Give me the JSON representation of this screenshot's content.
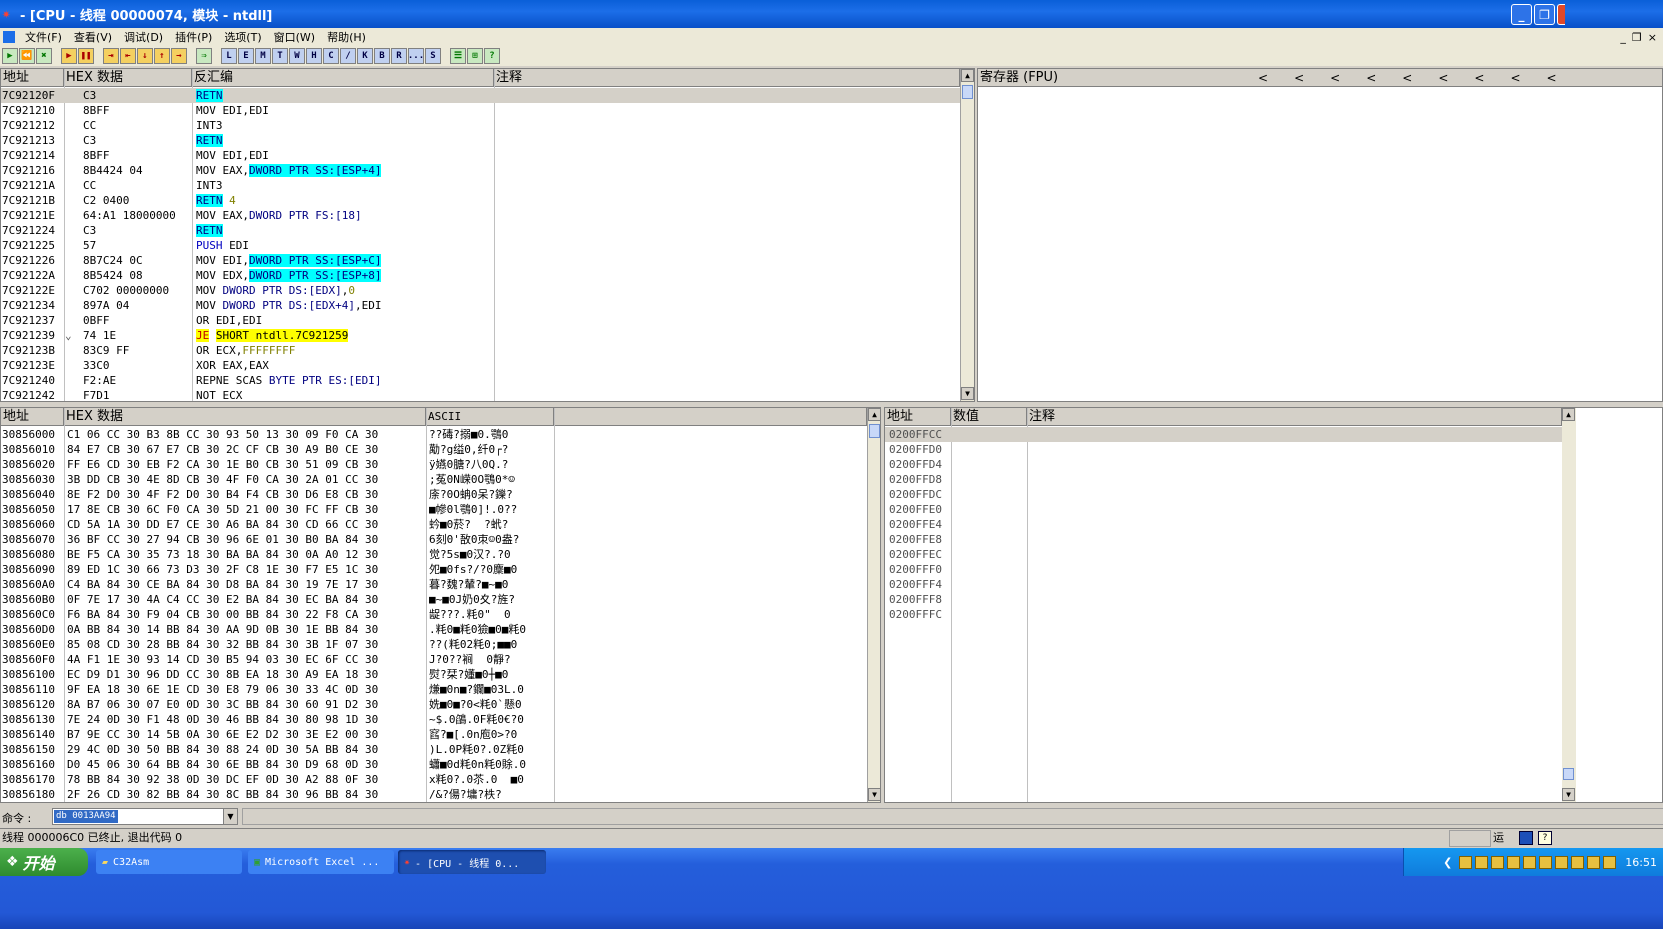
{
  "window": {
    "title": "- [CPU - 线程 00000074, 模块 - ntdll]",
    "app_icon": "star-icon",
    "min_label": "_",
    "max_label": "❐",
    "close_label": "×"
  },
  "menu": {
    "items": [
      "文件(F)",
      "查看(V)",
      "调试(D)",
      "插件(P)",
      "选项(T)",
      "窗口(W)",
      "帮助(H)"
    ],
    "mdi_min": "_",
    "mdi_restore": "❐",
    "mdi_close": "×"
  },
  "toolbar": {
    "buttons": [
      "▶",
      "⏪",
      "✖",
      "▶",
      "❚❚",
      "⇥",
      "⇤",
      "↓",
      "↑",
      "→",
      "⇒",
      "L",
      "E",
      "M",
      "T",
      "W",
      "H",
      "C",
      "/",
      "K",
      "B",
      "R",
      "...",
      "S",
      "☰",
      "⊞",
      "?"
    ]
  },
  "disasm": {
    "headers": {
      "addr": "地址",
      "hex": "HEX 数据",
      "disasm": "反汇编",
      "comment": "注释"
    },
    "rows": [
      {
        "addr": "7C92120F",
        "hex": "C3",
        "parts": [
          {
            "t": "RETN",
            "c": "cyan"
          }
        ],
        "sel": true
      },
      {
        "addr": "7C921210",
        "hex": "8BFF",
        "parts": [
          {
            "t": "MOV EDI,EDI"
          }
        ]
      },
      {
        "addr": "7C921212",
        "hex": "CC",
        "parts": [
          {
            "t": "INT3"
          }
        ]
      },
      {
        "addr": "7C921213",
        "hex": "C3",
        "parts": [
          {
            "t": "RETN",
            "c": "cyan"
          }
        ]
      },
      {
        "addr": "7C921214",
        "hex": "8BFF",
        "parts": [
          {
            "t": "MOV EDI,EDI"
          }
        ]
      },
      {
        "addr": "7C921216",
        "hex": "8B4424 04",
        "parts": [
          {
            "t": "MOV EAX,"
          },
          {
            "t": "DWORD PTR SS:[ESP+4]",
            "c": "cyan"
          }
        ]
      },
      {
        "addr": "7C92121A",
        "hex": "CC",
        "parts": [
          {
            "t": "INT3"
          }
        ]
      },
      {
        "addr": "7C92121B",
        "hex": "C2 0400",
        "parts": [
          {
            "t": "RETN",
            "c": "cyan"
          },
          {
            "t": " 4",
            "c": "num"
          }
        ]
      },
      {
        "addr": "7C92121E",
        "hex": "64:A1 18000000",
        "parts": [
          {
            "t": "MOV EAX,"
          },
          {
            "t": "DWORD PTR FS:[18]",
            "c": "mem"
          }
        ]
      },
      {
        "addr": "7C921224",
        "hex": "C3",
        "parts": [
          {
            "t": "RETN",
            "c": "cyan"
          }
        ]
      },
      {
        "addr": "7C921225",
        "hex": "57",
        "parts": [
          {
            "t": "PUSH",
            "c": "push"
          },
          {
            "t": " EDI"
          }
        ]
      },
      {
        "addr": "7C921226",
        "hex": "8B7C24 0C",
        "parts": [
          {
            "t": "MOV EDI,"
          },
          {
            "t": "DWORD PTR SS:[ESP+C]",
            "c": "cyan"
          }
        ]
      },
      {
        "addr": "7C92122A",
        "hex": "8B5424 08",
        "parts": [
          {
            "t": "MOV EDX,"
          },
          {
            "t": "DWORD PTR SS:[ESP+8]",
            "c": "cyan"
          }
        ]
      },
      {
        "addr": "7C92122E",
        "hex": "C702 00000000",
        "parts": [
          {
            "t": "MOV "
          },
          {
            "t": "DWORD PTR DS:[EDX]",
            "c": "mem"
          },
          {
            "t": ","
          },
          {
            "t": "0",
            "c": "num"
          }
        ]
      },
      {
        "addr": "7C921234",
        "hex": "897A 04",
        "parts": [
          {
            "t": "MOV "
          },
          {
            "t": "DWORD PTR DS:[EDX+4]",
            "c": "mem"
          },
          {
            "t": ",EDI"
          }
        ]
      },
      {
        "addr": "7C921237",
        "hex": "0BFF",
        "parts": [
          {
            "t": "OR EDI,EDI"
          }
        ]
      },
      {
        "addr": "7C921239",
        "hex": "74 1E",
        "mark": "⌄",
        "parts": [
          {
            "t": "JE",
            "c": "jmp"
          },
          {
            "t": " "
          },
          {
            "t": "SHORT ntdll.7C921259",
            "c": "yel"
          }
        ]
      },
      {
        "addr": "7C92123B",
        "hex": "83C9 FF",
        "parts": [
          {
            "t": "OR ECX,"
          },
          {
            "t": "FFFFFFFF",
            "c": "num"
          }
        ]
      },
      {
        "addr": "7C92123E",
        "hex": "33C0",
        "parts": [
          {
            "t": "XOR EAX,EAX"
          }
        ]
      },
      {
        "addr": "7C921240",
        "hex": "F2:AE",
        "parts": [
          {
            "t": "REPNE SCAS "
          },
          {
            "t": "BYTE PTR ES:[EDI]",
            "c": "mem"
          }
        ]
      },
      {
        "addr": "7C921242",
        "hex": "F7D1",
        "parts": [
          {
            "t": "NOT ECX"
          }
        ]
      }
    ]
  },
  "registers": {
    "header": "寄存器 (FPU)",
    "arrows": [
      "<",
      "<",
      "<",
      "<",
      "<",
      "<",
      "<",
      "<",
      "<"
    ]
  },
  "dump": {
    "headers": {
      "addr": "地址",
      "hex": "HEX 数据",
      "ascii": "ASCII"
    },
    "rows": [
      {
        "addr": "30856000",
        "hex": "C1 06 CC 30 B3 8B CC 30 93 50 13 30 09 F0 CA 30",
        "ascii": "??碡?搦■0.鶚0"
      },
      {
        "addr": "30856010",
        "hex": "84 E7 CB 30 67 E7 CB 30 2C CF CB 30 A9 B0 CE 30",
        "ascii": "勱?g缢0,纤0┌?"
      },
      {
        "addr": "30856020",
        "hex": "FF E6 CD 30 EB F2 CA 30 1E B0 CB 30 51 09 CB 30",
        "ascii": "ÿ嬿0膅?八0Q.?"
      },
      {
        "addr": "30856030",
        "hex": "3B DD CB 30 4E 8D CB 30 4F F0 CA 30 2A 01 CC 30",
        "ascii": ";菟0N嵘0O鶚0*☺"
      },
      {
        "addr": "30856040",
        "hex": "8E F2 D0 30 4F F2 D0 30 B4 F4 CB 30 D6 E8 CB 30",
        "ascii": "庩?0O蚺0呆?鑠?"
      },
      {
        "addr": "30856050",
        "hex": "17 8E CB 30 6C F0 CA 30 5D 21 00 30 FC FF CB 30",
        "ascii": "■幓0l鶚0]!.0??"
      },
      {
        "addr": "30856060",
        "hex": "CD 5A 1A 30 DD E7 CE 30 A6 BA 84 30 CD 66 CC 30",
        "ascii": "蚙■0菸?  ?蚮?"
      },
      {
        "addr": "30856070",
        "hex": "36 BF CC 30 27 94 CB 30 96 6E 01 30 B0 BA 84 30",
        "ascii": "6刻0'敔0朿☺0盎?"
      },
      {
        "addr": "30856080",
        "hex": "BE F5 CA 30 35 73 18 30 BA BA 84 30 0A A0 12 30",
        "ascii": "觉?5s■0汉?.?0"
      },
      {
        "addr": "30856090",
        "hex": "89 ED 1C 30 66 73 D3 30 2F C8 1E 30 F7 E5 1C 30",
        "ascii": "夗■0fs?/?0麇■0"
      },
      {
        "addr": "308560A0",
        "hex": "C4 BA 84 30 CE BA 84 30 D8 BA 84 30 19 7E 17 30",
        "ascii": "暮?魏?輦?■~■0"
      },
      {
        "addr": "308560B0",
        "hex": "0F 7E 17 30 4A C4 CC 30 E2 BA 84 30 EC BA 84 30",
        "ascii": "■~■0J奶0夊?旌?"
      },
      {
        "addr": "308560C0",
        "hex": "F6 BA 84 30 F9 04 CB 30 00 BB 84 30 22 F8 CA 30",
        "ascii": "龊???.粍0\"  0"
      },
      {
        "addr": "308560D0",
        "hex": "0A BB 84 30 14 BB 84 30 AA 9D 0B 30 1E BB 84 30",
        "ascii": ".粍0■粍0獫■0■粍0"
      },
      {
        "addr": "308560E0",
        "hex": "85 08 CD 30 28 BB 84 30 32 BB 84 30 3B 1F 07 30",
        "ascii": "??(粍02粍0;■■0"
      },
      {
        "addr": "308560F0",
        "hex": "4A F1 1E 30 93 14 CD 30 B5 94 03 30 EC 6F CC 30",
        "ascii": "J?0??裥  0靜?"
      },
      {
        "addr": "30856100",
        "hex": "EC D9 D1 30 96 DD CC 30 8B EA 18 30 A9 EA 18 30",
        "ascii": "熨?栞?嬞■0┼■0"
      },
      {
        "addr": "30856110",
        "hex": "9F EA 18 30 6E 1E CD 30 E8 79 06 30 33 4C 0D 30",
        "ascii": "熑■0n■?鑭■03L.0"
      },
      {
        "addr": "30856120",
        "hex": "8A B7 06 30 07 E0 0D 30 3C BB 84 30 60 91 D2 30",
        "ascii": "姺■0■?0<粍0`懸0"
      },
      {
        "addr": "30856130",
        "hex": "7E 24 0D 30 F1 48 0D 30 46 BB 84 30 80 98 1D 30",
        "ascii": "~$.0鵮.0F粍0€?0"
      },
      {
        "addr": "30856140",
        "hex": "B7 9E CC 30 14 5B 0A 30 6E E2 D2 30 3E E2 00 30",
        "ascii": "窞?■[.0n庖0>?0"
      },
      {
        "addr": "30856150",
        "hex": "29 4C 0D 30 50 BB 84 30 88 24 0D 30 5A BB 84 30",
        "ascii": ")L.0P粍0?.0Z粍0"
      },
      {
        "addr": "30856160",
        "hex": "D0 45 06 30 64 BB 84 30 6E BB 84 30 D9 68 0D 30",
        "ascii": "蠨■0d粍0n粍0賖.0"
      },
      {
        "addr": "30856170",
        "hex": "78 BB 84 30 92 38 0D 30 DC EF 0D 30 A2 88 0F 30",
        "ascii": "x粍0?.0苶.0  ■0"
      },
      {
        "addr": "30856180",
        "hex": "2F 26 CD 30 82 BB 84 30 8C BB 84 30 96 BB 84 30",
        "ascii": "/&?偒?墉?柣?"
      }
    ]
  },
  "stack": {
    "headers": {
      "addr": "地址",
      "value": "数值",
      "comment": "注释"
    },
    "rows": [
      "0200FFCC",
      "0200FFD0",
      "0200FFD4",
      "0200FFD8",
      "0200FFDC",
      "0200FFE0",
      "0200FFE4",
      "0200FFE8",
      "0200FFEC",
      "0200FFF0",
      "0200FFF4",
      "0200FFF8",
      "0200FFFC"
    ]
  },
  "command": {
    "label": "命令 :",
    "value": "db 0013AA94"
  },
  "status": {
    "text": "线程 000006C0 已终止, 退出代码 0",
    "right": "运"
  },
  "taskbar": {
    "start": "开始",
    "tasks": [
      "C32Asm",
      "Microsoft Excel ...",
      "- [CPU - 线程 0..."
    ],
    "clock": "16:51"
  },
  "colors": {
    "cyan_highlight": "#00ffff",
    "yellow_highlight": "#ffff00",
    "taskbar_blue": "#245edb",
    "title_blue": "#0a5fd8"
  }
}
